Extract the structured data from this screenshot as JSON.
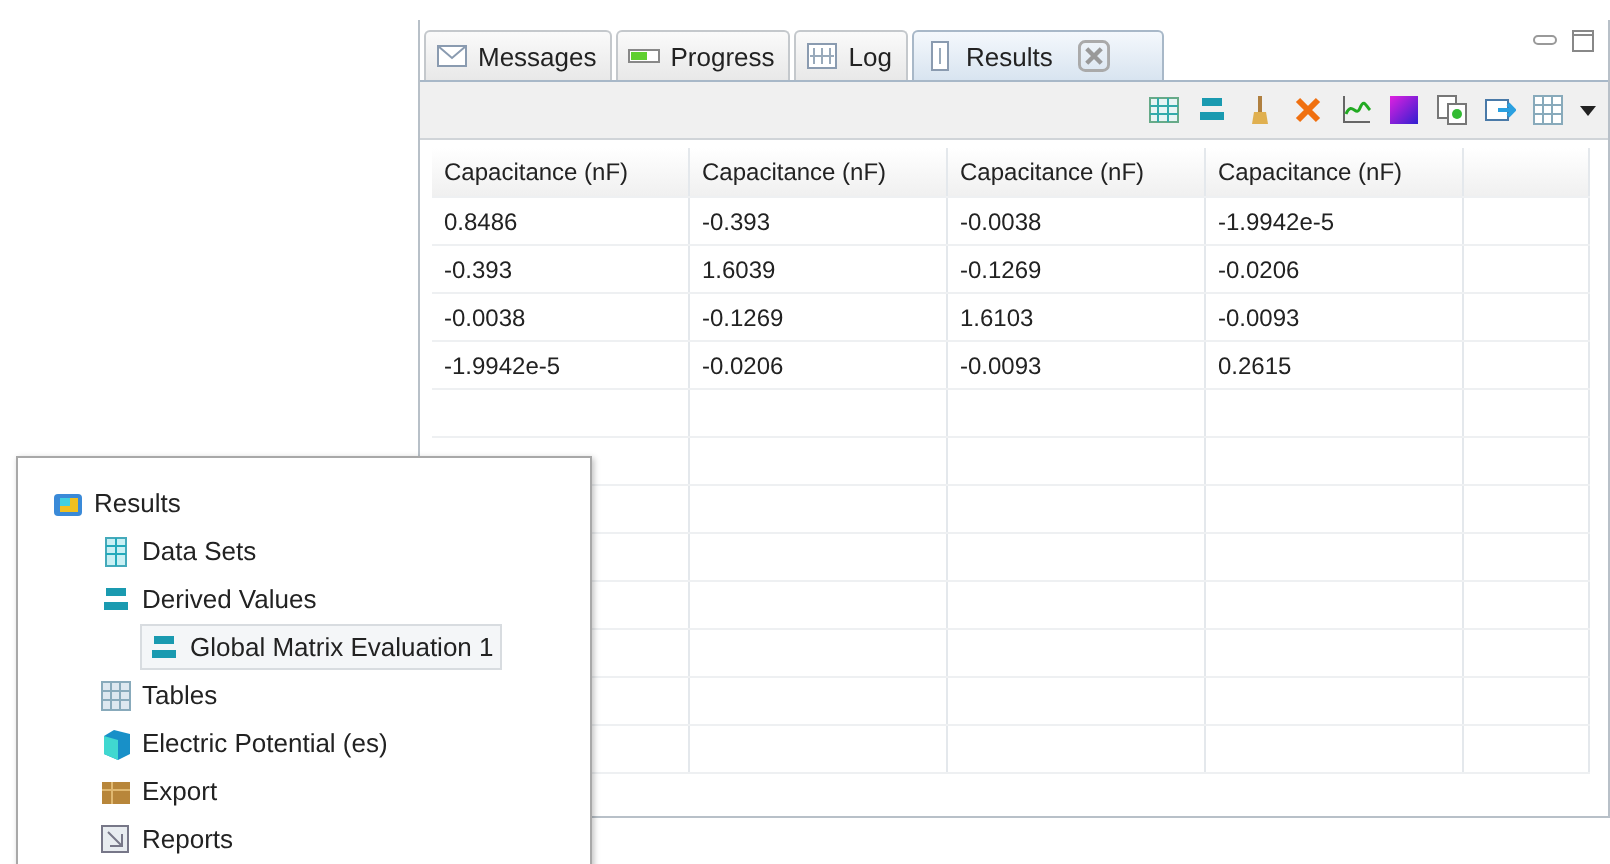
{
  "results_window": {
    "tabs": [
      {
        "label": "Messages",
        "selected": false
      },
      {
        "label": "Progress",
        "selected": false
      },
      {
        "label": "Log",
        "selected": false
      },
      {
        "label": "Results",
        "selected": true
      }
    ],
    "table": {
      "columns": [
        "Capacitance (nF)",
        "Capacitance (nF)",
        "Capacitance (nF)",
        "Capacitance (nF)"
      ],
      "rows": [
        [
          "0.8486",
          "-0.393",
          "-0.0038",
          "-1.9942e-5"
        ],
        [
          "-0.393",
          "1.6039",
          "-0.1269",
          "-0.0206"
        ],
        [
          "-0.0038",
          "-0.1269",
          "1.6103",
          "-0.0093"
        ],
        [
          "-1.9942e-5",
          "-0.0206",
          "-0.0093",
          "0.2615"
        ]
      ]
    }
  },
  "model_tree": {
    "items": [
      {
        "label": "Results",
        "selected": false,
        "children": [
          {
            "label": "Data Sets",
            "selected": false
          },
          {
            "label": "Derived Values",
            "selected": false,
            "children": [
              {
                "label": "Global Matrix Evaluation 1",
                "selected": true
              }
            ]
          },
          {
            "label": "Tables",
            "selected": false
          },
          {
            "label": "Electric Potential (es)",
            "selected": false
          },
          {
            "label": "Export",
            "selected": false
          },
          {
            "label": "Reports",
            "selected": false
          }
        ]
      }
    ]
  }
}
